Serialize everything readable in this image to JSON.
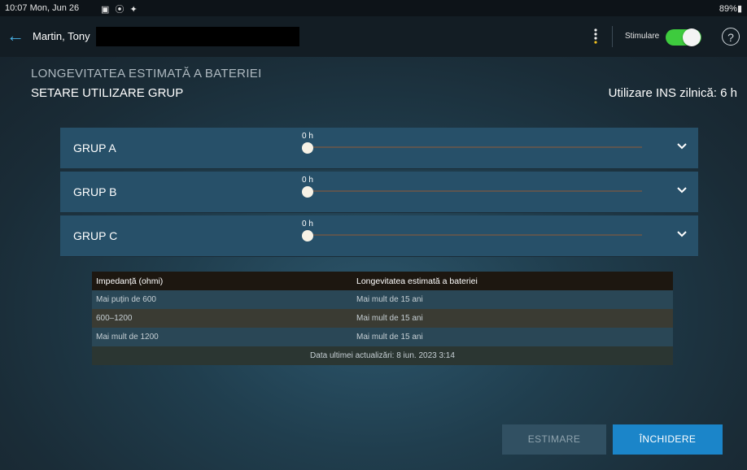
{
  "status_bar": {
    "time": "10:07  Mon, Jun 26",
    "icons": "▣ ⦿ ✦",
    "battery": "89%▮"
  },
  "app_bar": {
    "back_icon": "←",
    "patient_name": "Martin, Tony",
    "stimulation_label": "Stimulare",
    "stimulation_on": true,
    "help_icon": "?",
    "accent_color": "#4ab3e8",
    "toggle_color": "#3ecb3e"
  },
  "main": {
    "section_title": "LONGEVITATEA ESTIMATĂ A BATERIEI",
    "subsection_title": "SETARE UTILIZARE GRUP",
    "daily_usage": "Utilizare INS zilnică: 6 h",
    "groups": [
      {
        "label": "GRUP A",
        "value": "0 h",
        "level_hours": 0
      },
      {
        "label": "GRUP B",
        "value": "0 h",
        "level_hours": 0
      },
      {
        "label": "GRUP C",
        "value": "0 h",
        "level_hours": 0
      }
    ]
  },
  "table": {
    "headers": [
      "Impedanță (ohmi)",
      "Longevitatea estimată a bateriei"
    ],
    "rows": [
      [
        "Mai puțin de 600",
        "Mai mult de 15 ani"
      ],
      [
        "600–1200",
        "Mai mult de 15 ani"
      ],
      [
        "Mai mult de 1200",
        "Mai mult de 15 ani"
      ]
    ],
    "footer": "Data ultimei actualizări: 8 iun. 2023 3:14"
  },
  "buttons": {
    "estimate": "ESTIMARE",
    "close": "ÎNCHIDERE"
  }
}
